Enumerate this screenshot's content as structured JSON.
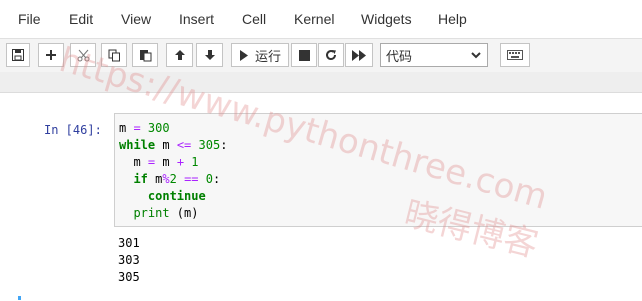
{
  "menu": [
    "File",
    "Edit",
    "View",
    "Insert",
    "Cell",
    "Kernel",
    "Widgets",
    "Help"
  ],
  "toolbar": {
    "run_label": "运行",
    "cell_type": "代码",
    "icons": [
      "save-icon",
      "plus-icon",
      "scissors-icon",
      "copy-icon",
      "paste-icon",
      "arrow-up-icon",
      "arrow-down-icon",
      "play-icon",
      "stop-icon",
      "restart-icon",
      "fast-forward-icon",
      "keyboard-icon"
    ]
  },
  "cell": {
    "prompt": "In [46]:",
    "code_lines": [
      "m = 300",
      "while m <= 305:",
      "  m = m + 1",
      "  if m%2 == 0:",
      "    continue",
      "  print (m)"
    ],
    "output_lines": [
      "301",
      "303",
      "305"
    ]
  },
  "watermark": {
    "url": "https://www.pythonthree.com",
    "text": "晓得博客"
  }
}
